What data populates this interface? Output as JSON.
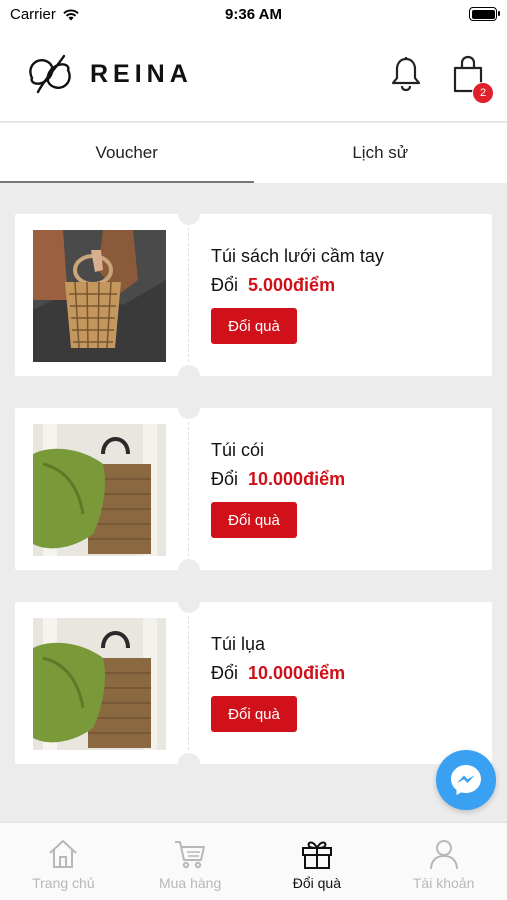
{
  "status_bar": {
    "carrier": "Carrier",
    "time": "9:36 AM"
  },
  "header": {
    "brand": "REINA",
    "cart_count": "2"
  },
  "tabs": [
    {
      "label": "Voucher",
      "active": true
    },
    {
      "label": "Lịch sử",
      "active": false
    }
  ],
  "vouchers": [
    {
      "name": "Túi sách lưới cầm tay",
      "points_label": "Đổi",
      "points": "5.000điểm",
      "button": "Đổi quà"
    },
    {
      "name": "Túi cói",
      "points_label": "Đổi",
      "points": "10.000điểm",
      "button": "Đổi quà"
    },
    {
      "name": "Túi lụa",
      "points_label": "Đổi",
      "points": "10.000điểm",
      "button": "Đổi quà"
    }
  ],
  "bottom_nav": [
    {
      "label": "Trang chủ",
      "icon": "home-icon",
      "active": false
    },
    {
      "label": "Mua hàng",
      "icon": "cart-icon",
      "active": false
    },
    {
      "label": "Đổi quà",
      "icon": "gift-icon",
      "active": true
    },
    {
      "label": "Tài khoản",
      "icon": "user-icon",
      "active": false
    }
  ],
  "colors": {
    "accent": "#d0111a",
    "badge": "#e0202a",
    "messenger": "#3aa0f2",
    "background": "#ececec"
  }
}
